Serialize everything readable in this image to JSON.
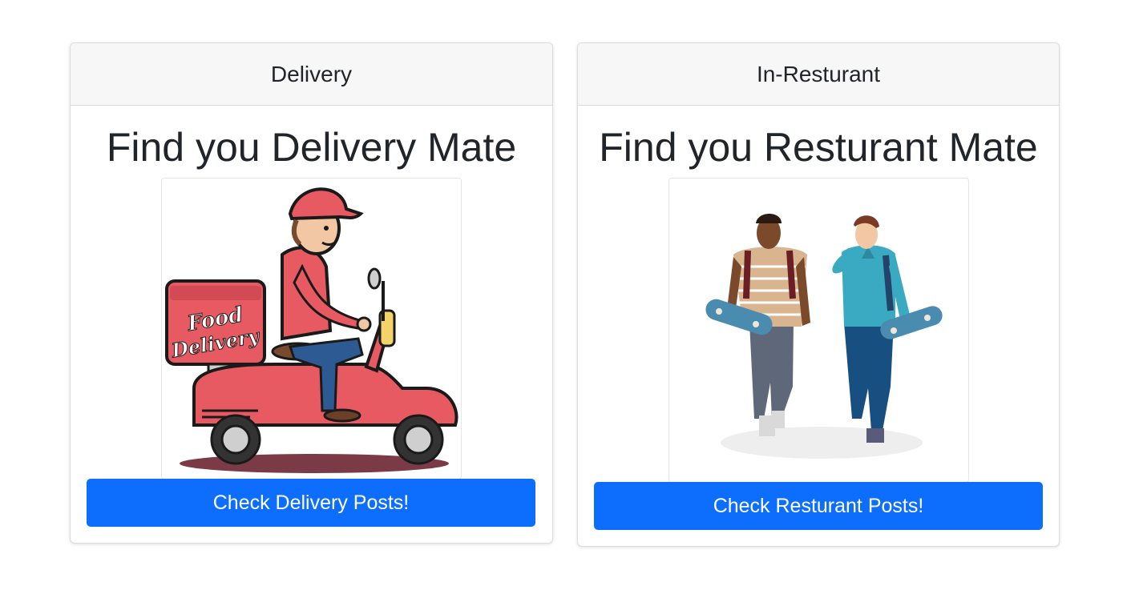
{
  "cards": [
    {
      "header": "Delivery",
      "title": "Find you Delivery Mate",
      "image_text_line1": "Food",
      "image_text_line2": "Delivery",
      "button_label": "Check Delivery Posts!"
    },
    {
      "header": "In-Resturant",
      "title": "Find you Resturant Mate",
      "button_label": "Check Resturant Posts!"
    }
  ],
  "colors": {
    "button": "#0d6efd",
    "scooter": "#e85a62",
    "shirt": "#e85a62"
  }
}
